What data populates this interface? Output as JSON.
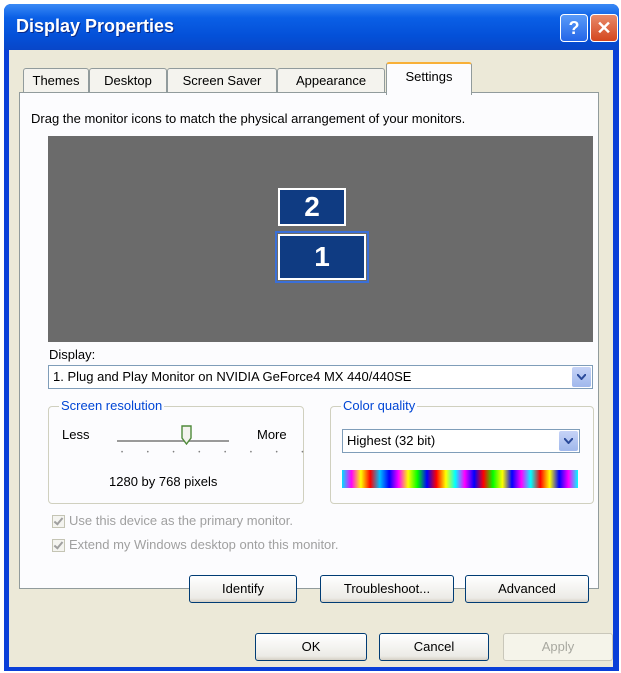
{
  "window": {
    "title": "Display Properties",
    "help_label": "?",
    "close_label": "✕"
  },
  "tabs": [
    "Themes",
    "Desktop",
    "Screen Saver",
    "Appearance",
    "Settings"
  ],
  "active_tab": "Settings",
  "settings": {
    "instructions": "Drag the monitor icons to match the physical arrangement of your monitors.",
    "monitors": [
      "2",
      "1"
    ],
    "display_label": "Display:",
    "display_value": "1. Plug and Play Monitor on NVIDIA GeForce4 MX 440/440SE",
    "resolution": {
      "group_label": "Screen resolution",
      "less_label": "Less",
      "more_label": "More",
      "value_text": "1280 by 768 pixels",
      "slider_position": 0.62
    },
    "color_quality": {
      "group_label": "Color quality",
      "selected": "Highest (32 bit)"
    },
    "checkboxes": [
      {
        "label": "Use this device as the primary monitor.",
        "checked": true,
        "enabled": false
      },
      {
        "label": "Extend my Windows desktop onto this monitor.",
        "checked": true,
        "enabled": false
      }
    ],
    "buttons": [
      "Identify",
      "Troubleshoot...",
      "Advanced"
    ]
  },
  "footer_buttons": {
    "ok": "OK",
    "cancel": "Cancel",
    "apply": "Apply"
  },
  "colors": {
    "titlebar": "#0450d8",
    "monitor_bg": "#6b6b6b",
    "monitor_fill": "#0f3b82",
    "dialog_bg": "#ece9d8",
    "active_tab_accent": "#f8b038"
  }
}
